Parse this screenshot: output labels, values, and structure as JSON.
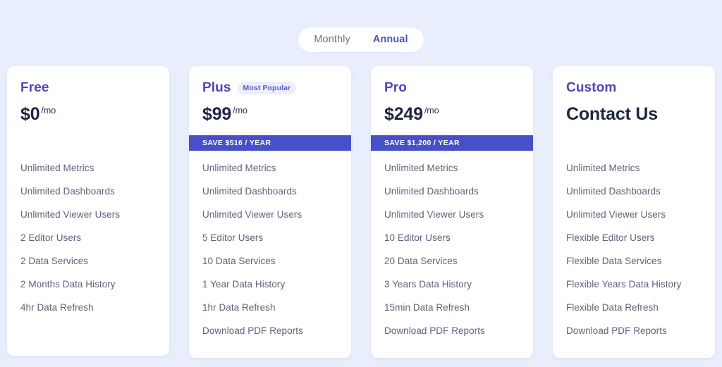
{
  "billing_toggle": {
    "options": [
      {
        "label": "Monthly",
        "active": false
      },
      {
        "label": "Annual",
        "active": true
      }
    ],
    "monthly_label": "Monthly",
    "annual_label": "Annual"
  },
  "colors": {
    "page_background": "#e8eefb",
    "card_background": "#ffffff",
    "plan_name": "#4f46b8",
    "price": "#1f2544",
    "feature_text": "#5c6478",
    "save_banner": "#4650c8",
    "badge_background": "#eceefb",
    "badge_text": "#5a5fc4",
    "toggle_active": "#4a52c4",
    "toggle_inactive": "#6b7390"
  },
  "plans": [
    {
      "name": "Free",
      "badge": "",
      "price_amount": "$0",
      "price_suffix": "/mo",
      "save_banner": "",
      "features": [
        "Unlimited Metrics",
        "Unlimited Dashboards",
        "Unlimited Viewer Users",
        "2 Editor Users",
        "2 Data Services",
        "2 Months Data History",
        "4hr Data Refresh"
      ]
    },
    {
      "name": "Plus",
      "badge": "Most Popular",
      "price_amount": "$99",
      "price_suffix": "/mo",
      "save_banner": "SAVE $516 / YEAR",
      "features": [
        "Unlimited Metrics",
        "Unlimited Dashboards",
        "Unlimited Viewer Users",
        "5 Editor Users",
        "10 Data Services",
        "1 Year Data History",
        "1hr Data Refresh",
        "Download PDF Reports"
      ]
    },
    {
      "name": "Pro",
      "badge": "",
      "price_amount": "$249",
      "price_suffix": "/mo",
      "save_banner": "SAVE $1,200 / YEAR",
      "features": [
        "Unlimited Metrics",
        "Unlimited Dashboards",
        "Unlimited Viewer Users",
        "10 Editor Users",
        "20 Data Services",
        "3 Years Data History",
        "15min Data Refresh",
        "Download PDF Reports"
      ]
    },
    {
      "name": "Custom",
      "badge": "",
      "price_amount": "Contact Us",
      "price_suffix": "",
      "save_banner": "",
      "features": [
        "Unlimited Metrics",
        "Unlimited Dashboards",
        "Unlimited Viewer Users",
        "Flexible Editor Users",
        "Flexible Data Services",
        "Flexible Years Data History",
        "Flexible Data Refresh",
        "Download PDF Reports"
      ]
    }
  ]
}
